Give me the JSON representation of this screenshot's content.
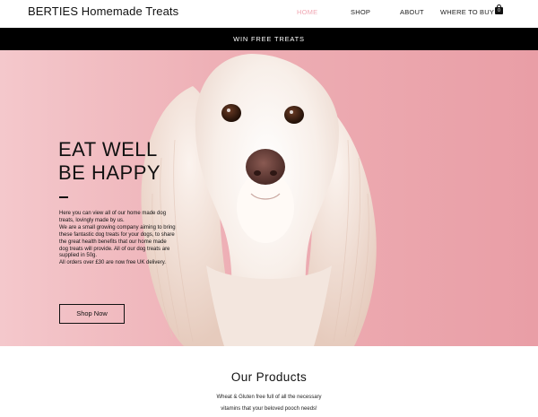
{
  "brand": "BERTIES Homemade Treats",
  "nav": {
    "home": "HOME",
    "shop": "SHOP",
    "about": "ABOUT",
    "where": "WHERE TO BUY"
  },
  "cart": {
    "count": "0"
  },
  "promo": "WIN FREE TREATS",
  "hero": {
    "title_line1": "EAT WELL",
    "title_line2": "BE HAPPY",
    "paragraphs": [
      "Here you can view all of our home made dog treats, lovingly made by us.",
      "We are a small growing company aiming to bring these fantastic dog treats for your dogs, to share the great health benefits that our home made dog treats will provide. All of our dog treats are supplied in 50g.",
      "All orders over £30 are now free UK delivery."
    ],
    "button": "Shop Now"
  },
  "products": {
    "title": "Our Products",
    "line1": "Wheat & Gluten free full of all the necessary",
    "line2": "vitamins that your beloved pooch needs!"
  },
  "colors": {
    "accent": "#f0a8b3",
    "banner": "#000000",
    "hero_bg": "#eeb0b6"
  }
}
